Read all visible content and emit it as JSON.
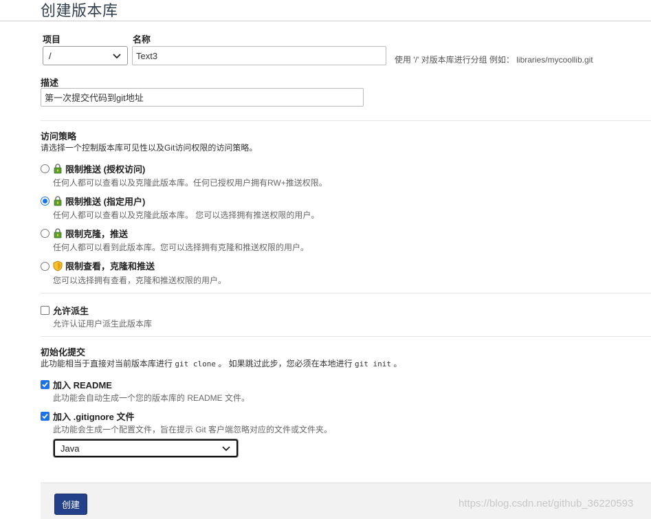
{
  "page": {
    "title": "创建版本库"
  },
  "form": {
    "project_label": "项目",
    "project_value": "/",
    "name_label": "名称",
    "name_value": "Text3",
    "name_hint": "使用 '/' 对版本库进行分组 例如： libraries/mycoollib.git",
    "description_label": "描述",
    "description_value": "第一次提交代码到git地址"
  },
  "access": {
    "title": "访问策略",
    "subtitle": "请选择一个控制版本库可见性以及Git访问权限的访问策略。",
    "options": [
      {
        "title": "限制推送 (授权访问)",
        "desc": "任何人都可以查看以及克隆此版本库。任何已授权用户拥有RW+推送权限。",
        "icon": "lock-green-icon",
        "checked": false
      },
      {
        "title": "限制推送 (指定用户)",
        "desc": "任何人都可以查看以及克隆此版本库。 您可以选择拥有推送权限的用户。",
        "icon": "lock-green-icon",
        "checked": true
      },
      {
        "title": "限制克隆，推送",
        "desc": "任何人都可以看到此版本库。您可以选择拥有克隆和推送权限的用户。",
        "icon": "lock-green-icon",
        "checked": false
      },
      {
        "title": "限制查看，克隆和推送",
        "desc": "您可以选择拥有查看，克隆和推送权限的用户。",
        "icon": "shield-yellow-icon",
        "checked": false
      }
    ]
  },
  "fork": {
    "title": "允许派生",
    "desc": "允许认证用户派生此版本库",
    "checked": false
  },
  "init": {
    "title": "初始化提交",
    "desc_pre": "此功能相当于直接对当前版本库进行",
    "desc_code1": "git clone",
    "desc_mid": "。 如果跳过此步，您必须在本地进行",
    "desc_code2": "git init",
    "desc_post": "。",
    "readme_title": "加入 README",
    "readme_desc": "此功能会自动生成一个您的版本库的 README 文件。",
    "readme_checked": true,
    "gitignore_title": "加入 .gitignore 文件",
    "gitignore_desc": "此功能会生成一个配置文件，旨在提示 Git 客户端忽略对应的文件或文件夹。",
    "gitignore_checked": true,
    "gitignore_template": "Java"
  },
  "actions": {
    "create_label": "创建"
  },
  "watermark": "https://blog.csdn.net/github_36220593",
  "colors": {
    "accent": "#1a73e8",
    "button": "#23408a",
    "title": "#2f3d4c",
    "lock": "#5a9e2f",
    "shield": "#e8b01a"
  }
}
